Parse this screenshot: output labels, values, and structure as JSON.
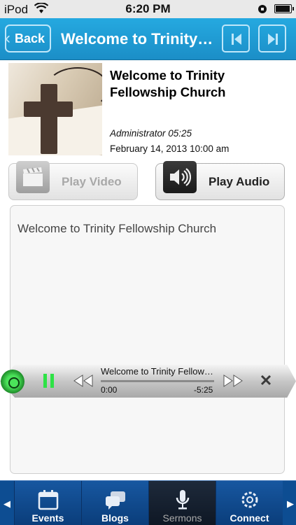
{
  "status_bar": {
    "carrier": "iPod",
    "time": "6:20 PM",
    "battery_level": 0.85
  },
  "nav": {
    "back_label": "Back",
    "title": "Welcome to Trinity Fellowship Church"
  },
  "sermon": {
    "title": "Welcome to Trinity Fellowship Church",
    "author_line": "Administrator 05:25",
    "date": "February 14, 2013 10:00 am",
    "image_alt": "wooden cross on open book"
  },
  "actions": {
    "play_video": "Play Video",
    "play_audio": "Play Audio"
  },
  "description": {
    "text": "Welcome to Trinity Fellowship Church"
  },
  "player": {
    "track": "Welcome to Trinity Fellowship Church",
    "elapsed": "0:00",
    "remaining": "-5:25",
    "progress": 0.0
  },
  "tabs": [
    {
      "label": "Events",
      "icon": "calendar-icon"
    },
    {
      "label": "Blogs",
      "icon": "chat-bubbles-icon"
    },
    {
      "label": "Sermons",
      "icon": "microphone-icon",
      "active": true
    },
    {
      "label": "Connect",
      "icon": "connect-icon"
    }
  ],
  "colors": {
    "nav_blue": "#1b8ec7",
    "tab_blue": "#0d4d92",
    "player_green": "#2ee246"
  }
}
